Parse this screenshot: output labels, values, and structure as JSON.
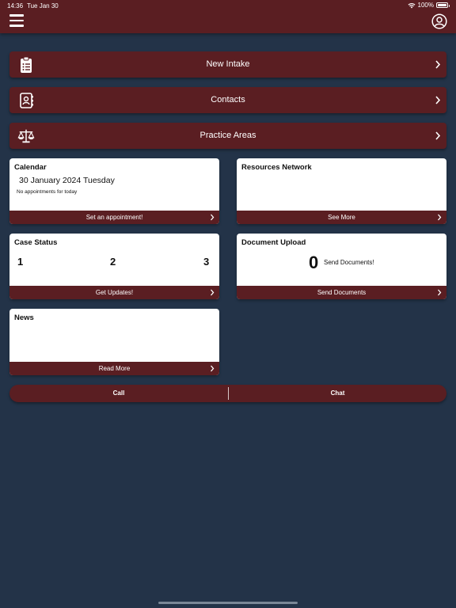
{
  "status_bar": {
    "time": "14:36",
    "date": "Tue Jan 30",
    "battery": "100%",
    "battery_level": 1.0
  },
  "nav": [
    {
      "label": "New Intake",
      "icon": "clipboard-icon"
    },
    {
      "label": "Contacts",
      "icon": "contact-book-icon"
    },
    {
      "label": "Practice Areas",
      "icon": "scales-icon"
    }
  ],
  "calendar": {
    "title": "Calendar",
    "date": "30 January 2024 Tuesday",
    "note": "No appointments for today",
    "action": "Set an appointment!"
  },
  "resources": {
    "title": "Resources Network",
    "action": "See More"
  },
  "case_status": {
    "title": "Case Status",
    "steps": [
      "1",
      "2",
      "3"
    ],
    "action": "Get Updates!"
  },
  "document_upload": {
    "title": "Document Upload",
    "count": "0",
    "label": "Send Documents!",
    "action": "Send Documents"
  },
  "news": {
    "title": "News",
    "action": "Read More"
  },
  "actions": {
    "call": "Call",
    "chat": "Chat"
  },
  "colors": {
    "background": "#233348",
    "accent": "#5a1e22",
    "card": "#ffffff"
  }
}
